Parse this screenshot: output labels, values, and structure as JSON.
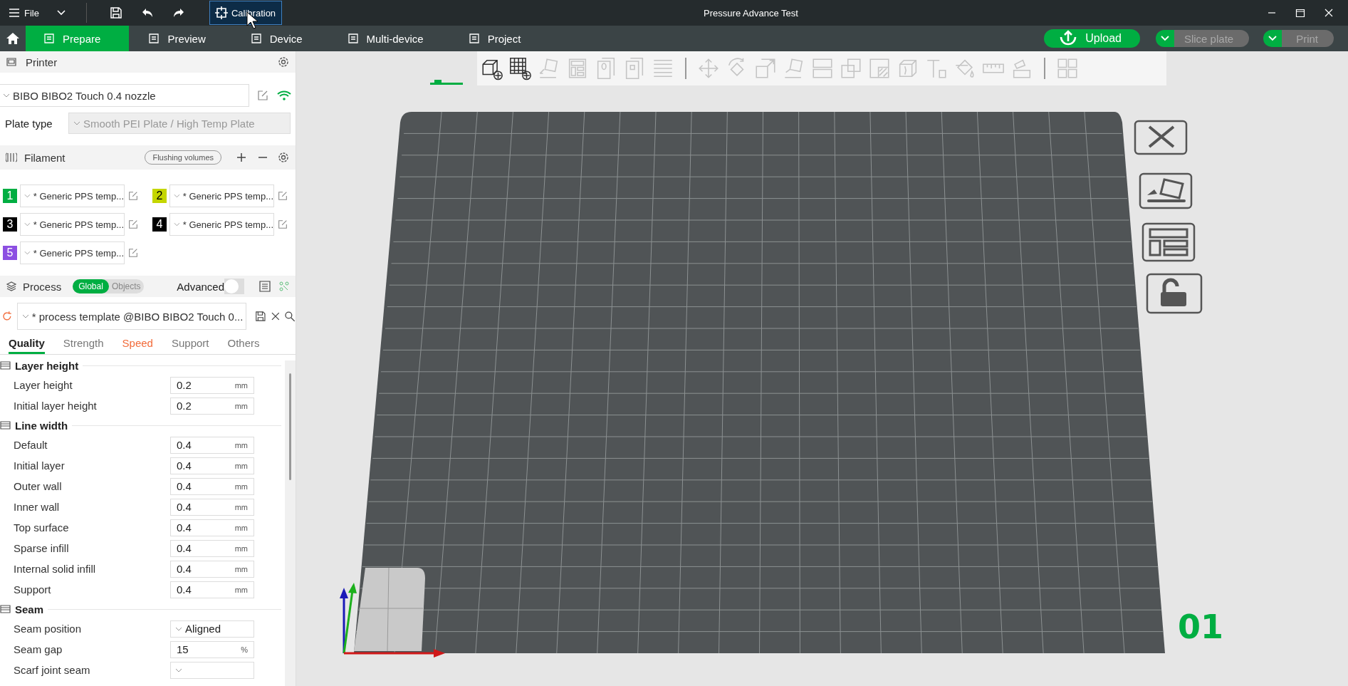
{
  "title_bar": {
    "menu": "File",
    "calibration": "Calibration",
    "title": "Pressure Advance Test"
  },
  "tabs": [
    {
      "label": "Prepare",
      "selected": true
    },
    {
      "label": "Preview",
      "selected": false
    },
    {
      "label": "Device",
      "selected": false
    },
    {
      "label": "Multi-device",
      "selected": false
    },
    {
      "label": "Project",
      "selected": false
    }
  ],
  "actions": {
    "upload": "Upload",
    "slice": {
      "label": "Slice plate",
      "disabled": true
    },
    "print": {
      "label": "Print",
      "disabled": true
    }
  },
  "printer": {
    "title": "Printer",
    "preset": "BIBO BIBO2 Touch 0.4 nozzle",
    "plate_label": "Plate type",
    "plate_value": "Smooth PEI Plate / High Temp Plate"
  },
  "filament": {
    "title": "Filament",
    "flushing": "Flushing volumes",
    "slots": [
      {
        "number": "1",
        "color": "#00ae42",
        "preset": "* Generic PPS temp..."
      },
      {
        "number": "2",
        "color": "#c4d600",
        "preset": "* Generic PPS temp..."
      },
      {
        "number": "3",
        "color": "#000000",
        "preset": "* Generic PPS temp..."
      },
      {
        "number": "4",
        "color": "#000000",
        "preset": "* Generic PPS temp..."
      },
      {
        "number": "5",
        "color": "#8c4fe2",
        "preset": "* Generic PPS temp..."
      }
    ]
  },
  "process": {
    "title": "Process",
    "modes": [
      {
        "label": "Global",
        "selected": true
      },
      {
        "label": "Objects",
        "selected": false
      }
    ],
    "advanced": "Advanced",
    "advanced_on": false,
    "preset": "* process template @BIBO BIBO2 Touch 0..."
  },
  "setting_tabs": [
    {
      "label": "Quality",
      "selected": true,
      "modified": false
    },
    {
      "label": "Strength",
      "selected": false,
      "modified": false
    },
    {
      "label": "Speed",
      "selected": false,
      "modified": true
    },
    {
      "label": "Support",
      "selected": false,
      "modified": false
    },
    {
      "label": "Others",
      "selected": false,
      "modified": false
    }
  ],
  "groups": [
    {
      "title": "Layer height",
      "rows": [
        {
          "label": "Layer height",
          "kind": "number",
          "value": "0.2",
          "unit": "mm"
        },
        {
          "label": "Initial layer height",
          "kind": "number",
          "value": "0.2",
          "unit": "mm"
        }
      ]
    },
    {
      "title": "Line width",
      "rows": [
        {
          "label": "Default",
          "kind": "number",
          "value": "0.4",
          "unit": "mm"
        },
        {
          "label": "Initial layer",
          "kind": "number",
          "value": "0.4",
          "unit": "mm"
        },
        {
          "label": "Outer wall",
          "kind": "number",
          "value": "0.4",
          "unit": "mm"
        },
        {
          "label": "Inner wall",
          "kind": "number",
          "value": "0.4",
          "unit": "mm"
        },
        {
          "label": "Top surface",
          "kind": "number",
          "value": "0.4",
          "unit": "mm"
        },
        {
          "label": "Sparse infill",
          "kind": "number",
          "value": "0.4",
          "unit": "mm"
        },
        {
          "label": "Internal solid infill",
          "kind": "number",
          "value": "0.4",
          "unit": "mm"
        },
        {
          "label": "Support",
          "kind": "number",
          "value": "0.4",
          "unit": "mm"
        }
      ]
    },
    {
      "title": "Seam",
      "rows": [
        {
          "label": "Seam position",
          "kind": "select",
          "value": "Aligned"
        },
        {
          "label": "Seam gap",
          "kind": "number",
          "value": "15",
          "unit": "%"
        },
        {
          "label": "Scarf joint seam",
          "kind": "select"
        }
      ]
    }
  ],
  "toolbar": [
    {
      "kind": "add-model",
      "disabled": false
    },
    {
      "kind": "add-plate",
      "disabled": false
    },
    {
      "kind": "auto-orient",
      "disabled": true
    },
    {
      "kind": "arrange",
      "disabled": true
    },
    {
      "kind": "split-objects",
      "disabled": true
    },
    {
      "kind": "split-parts",
      "disabled": true
    },
    {
      "kind": "layers",
      "disabled": true
    },
    {
      "kind": "separator"
    },
    {
      "kind": "move",
      "disabled": true
    },
    {
      "kind": "rotate",
      "disabled": true
    },
    {
      "kind": "scale",
      "disabled": true
    },
    {
      "kind": "lay-on-face",
      "disabled": true
    },
    {
      "kind": "cut",
      "disabled": true
    },
    {
      "kind": "boolean",
      "disabled": true
    },
    {
      "kind": "support-paint",
      "disabled": true
    },
    {
      "kind": "seam-paint",
      "disabled": true
    },
    {
      "kind": "text",
      "disabled": true
    },
    {
      "kind": "color-paint",
      "disabled": true
    },
    {
      "kind": "measure",
      "disabled": true
    },
    {
      "kind": "assembly",
      "disabled": true
    },
    {
      "kind": "separator"
    },
    {
      "kind": "explode",
      "disabled": true
    }
  ],
  "plate_number": "01"
}
